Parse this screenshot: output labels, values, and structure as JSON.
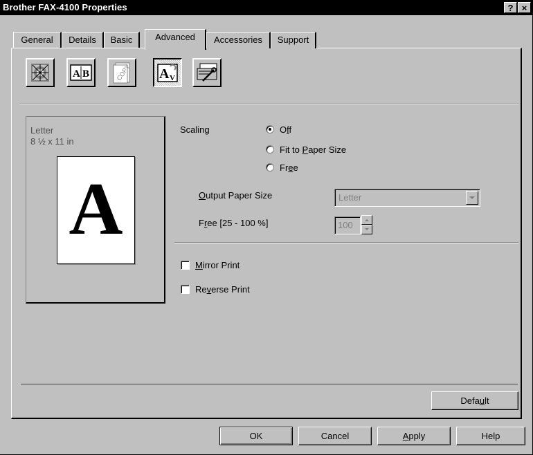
{
  "window": {
    "title": "Brother FAX-4100 Properties",
    "help_label": "?",
    "close_label": "×"
  },
  "tabs": [
    {
      "label": "General"
    },
    {
      "label": "Details"
    },
    {
      "label": "Basic"
    },
    {
      "label": "Advanced",
      "active": true
    },
    {
      "label": "Accessories"
    },
    {
      "label": "Support"
    }
  ],
  "toolbar_icons": [
    "print-quality-icon",
    "paper-layout-icon",
    "copy-icon",
    "text-scaling-icon",
    "device-options-icon"
  ],
  "preview": {
    "paper_name": "Letter",
    "paper_size": "8 ½ x 11 in",
    "sample_glyph": "A"
  },
  "scaling": {
    "label": "Scaling",
    "options": [
      {
        "pre": "O",
        "u": "f",
        "post": "f",
        "selected": true
      },
      {
        "pre": "Fit to ",
        "u": "P",
        "post": "aper Size",
        "selected": false
      },
      {
        "pre": "Fr",
        "u": "e",
        "post": "e",
        "selected": false
      }
    ]
  },
  "output_paper_size": {
    "label_u": "O",
    "label_rest": "utput Paper Size",
    "value": "Letter"
  },
  "free_percent": {
    "label_pre": "F",
    "label_u": "r",
    "label_post": "ee [25 - 100 %]",
    "value": "100"
  },
  "mirror_print": {
    "u": "M",
    "rest": "irror Print",
    "checked": false
  },
  "reverse_print": {
    "pre": "Re",
    "u": "v",
    "post": "erse Print",
    "checked": false
  },
  "default_button": {
    "pre": "Defa",
    "u": "u",
    "post": "lt"
  },
  "footer": {
    "ok": "OK",
    "cancel": "Cancel",
    "apply_u": "A",
    "apply_rest": "pply",
    "help": "Help"
  }
}
